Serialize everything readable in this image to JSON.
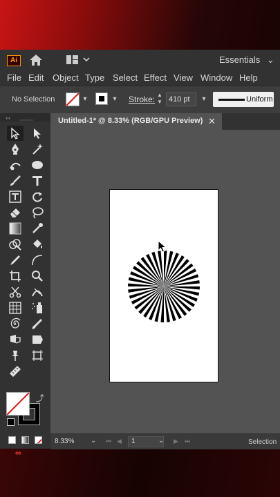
{
  "app": {
    "logo_text": "Ai",
    "workspace": "Essentials"
  },
  "menu": [
    "File",
    "Edit",
    "Object",
    "Type",
    "Select",
    "Effect",
    "View",
    "Window",
    "Help"
  ],
  "control": {
    "selection_state": "No Selection",
    "stroke_label": "Stroke:",
    "stroke_value": "410 pt",
    "profile": "Uniform"
  },
  "document": {
    "tab_title": "Untitled-1* @ 8.33% (RGB/GPU Preview)",
    "close_glyph": "✕"
  },
  "status": {
    "zoom": "8.33%",
    "page": "1",
    "tool_name": "Selection"
  },
  "colors": {
    "fill": "#ffffff",
    "stroke": "#000000",
    "accent": "#ff9a00"
  },
  "overlay_glyph": "∞"
}
